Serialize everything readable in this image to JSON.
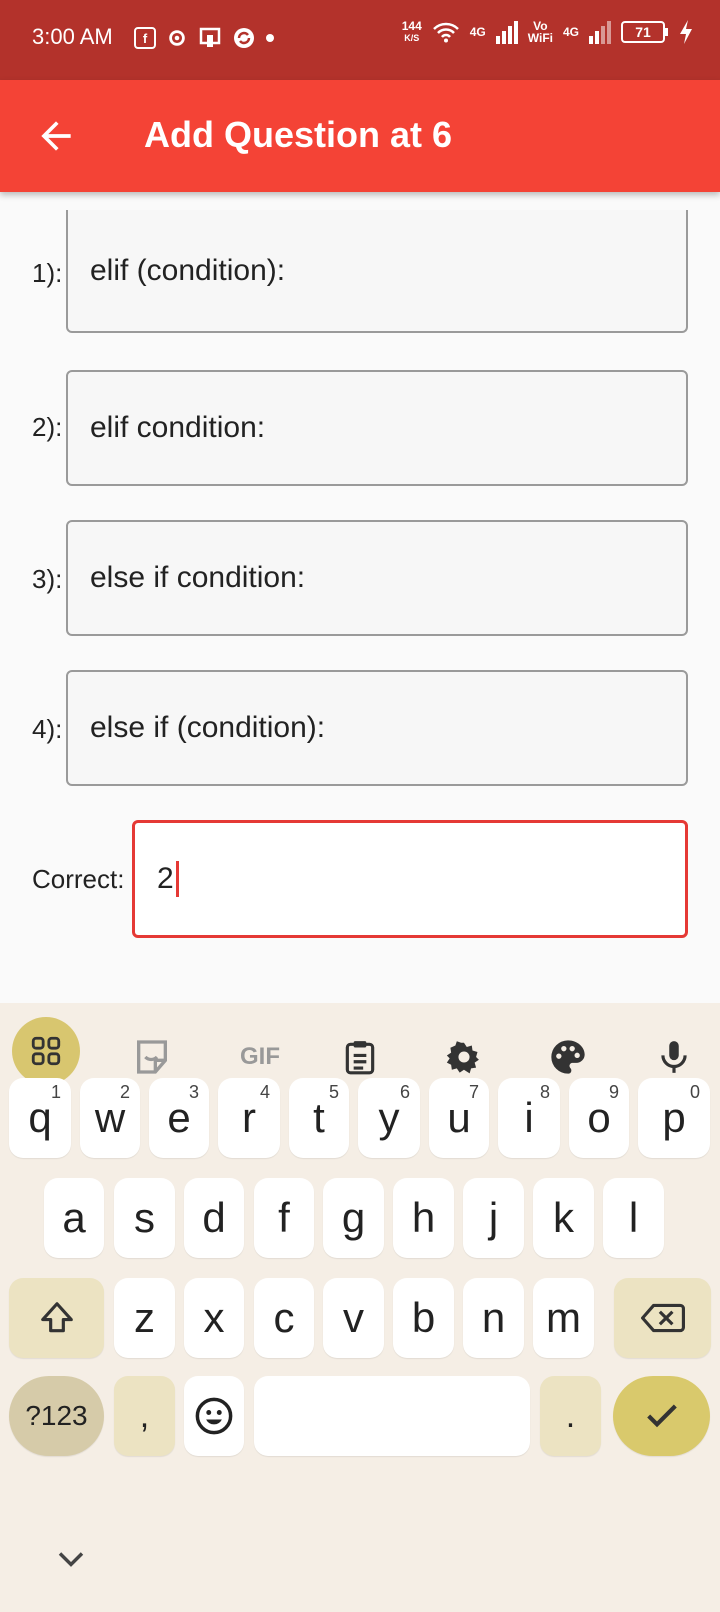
{
  "status_bar": {
    "time": "3:00 AM",
    "speed_value": "144",
    "speed_unit": "K/S",
    "net1": "4G",
    "vo": "Vo",
    "wifi_label": "WiFi",
    "net2": "4G",
    "battery": "71",
    "left_icons": [
      "facebook-icon",
      "settings-gear-icon",
      "cast-icon",
      "sync-icon",
      "dot-icon"
    ]
  },
  "app_bar": {
    "title": "Add Question at 6"
  },
  "options": [
    {
      "label": "1):",
      "value": "elif (condition):"
    },
    {
      "label": "2):",
      "value": "elif condition:"
    },
    {
      "label": "3):",
      "value": "else if condition:"
    },
    {
      "label": "4):",
      "value": "else if (condition):"
    }
  ],
  "correct": {
    "label": "Correct:",
    "value": "2"
  },
  "keyboard": {
    "toolbar": [
      "apps-grid-icon",
      "sticker-icon",
      "gif-icon",
      "clipboard-icon",
      "settings-icon",
      "palette-icon",
      "mic-icon"
    ],
    "gif_label": "GIF",
    "row1": [
      {
        "k": "q",
        "n": "1"
      },
      {
        "k": "w",
        "n": "2"
      },
      {
        "k": "e",
        "n": "3"
      },
      {
        "k": "r",
        "n": "4"
      },
      {
        "k": "t",
        "n": "5"
      },
      {
        "k": "y",
        "n": "6"
      },
      {
        "k": "u",
        "n": "7"
      },
      {
        "k": "i",
        "n": "8"
      },
      {
        "k": "o",
        "n": "9"
      },
      {
        "k": "p",
        "n": "0"
      }
    ],
    "row2": [
      "a",
      "s",
      "d",
      "f",
      "g",
      "h",
      "j",
      "k",
      "l"
    ],
    "row3": [
      "z",
      "x",
      "c",
      "v",
      "b",
      "n",
      "m"
    ],
    "symbols_label": "?123",
    "comma": ",",
    "period": "."
  },
  "colors": {
    "status_bar": "#b3322b",
    "app_bar": "#f44336",
    "accent": "#e53935",
    "keyboard_bg": "#f5eee5"
  }
}
